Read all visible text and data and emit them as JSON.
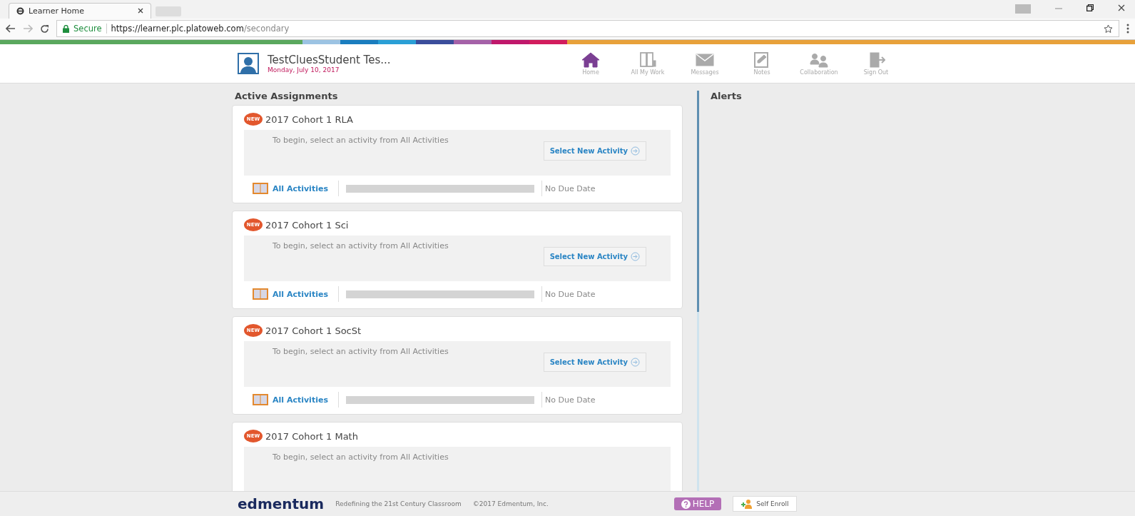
{
  "browser": {
    "tab_title": "Learner Home",
    "secure_label": "Secure",
    "url_host": "https://learner.plc.platoweb.com",
    "url_path": "/secondary"
  },
  "header": {
    "user_name": "TestCluesStudent Tes...",
    "date": "Monday, July 10, 2017",
    "nav": [
      {
        "label": "Home",
        "kind": "home",
        "selected": true
      },
      {
        "label": "All My Work",
        "kind": "work",
        "selected": false
      },
      {
        "label": "Messages",
        "kind": "messages",
        "selected": false
      },
      {
        "label": "Notes",
        "kind": "notes",
        "selected": false
      },
      {
        "label": "Collaboration",
        "kind": "collaboration",
        "selected": false
      },
      {
        "label": "Sign Out",
        "kind": "signout",
        "selected": false
      }
    ]
  },
  "assignments": {
    "heading": "Active Assignments",
    "items": [
      {
        "badge": "NEW",
        "title": "2017 Cohort 1 RLA",
        "message": "To begin, select an activity from All Activities",
        "button": "Select New Activity",
        "link": "All Activities",
        "progress": {
          "level": 0
        },
        "due": "No Due Date"
      },
      {
        "badge": "NEW",
        "title": "2017 Cohort 1 Sci",
        "message": "To begin, select an activity from All Activities",
        "button": "Select New Activity",
        "link": "All Activities",
        "progress": {
          "level": 0
        },
        "due": "No Due Date"
      },
      {
        "badge": "NEW",
        "title": "2017 Cohort 1 SocSt",
        "message": "To begin, select an activity from All Activities",
        "button": "Select New Activity",
        "link": "All Activities",
        "progress": {
          "level": 0
        },
        "due": "No Due Date"
      },
      {
        "badge": "NEW",
        "title": "2017 Cohort 1 Math",
        "message": "To begin, select an activity from All Activities"
      }
    ]
  },
  "alerts": {
    "heading": "Alerts"
  },
  "footer": {
    "logo": "edmentum",
    "tagline": "Redefining the 21st Century Classroom",
    "copyright": "©2017 Edmentum, Inc.",
    "help": "HELP",
    "enroll": "Self Enroll"
  }
}
